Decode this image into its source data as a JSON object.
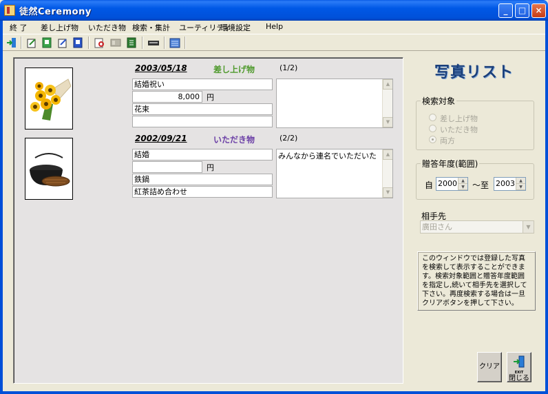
{
  "window": {
    "title": "徒然Ceremony",
    "min": "_",
    "max": "□",
    "close": "×"
  },
  "menu": [
    "終 了",
    "差し上げ物",
    "いただき物",
    "検索・集計",
    "ユーティリティ",
    "環境設定",
    "Help"
  ],
  "results": [
    {
      "date": "2003/05/18",
      "category": "差し上げ物",
      "counter": "(1/2)",
      "purpose": "結婚祝い",
      "amount": "8,000",
      "unit": "円",
      "item": "花束",
      "extra": "",
      "memo": "",
      "photo": "sunflower-bouquet"
    },
    {
      "date": "2002/09/21",
      "category": "いただき物",
      "counter": "(2/2)",
      "purpose": "結婚",
      "amount": "",
      "unit": "円",
      "item": "鉄鍋",
      "extra": "紅茶詰め合わせ",
      "memo": "みんなから連名でいただいた",
      "photo": "iron-pot"
    }
  ],
  "panel": {
    "heading": "写真リスト",
    "search_target": {
      "label": "検索対象",
      "options": [
        "差し上げ物",
        "いただき物",
        "両方"
      ],
      "selected": "両方"
    },
    "year_range": {
      "label": "贈答年度(範囲)",
      "from_label": "自",
      "from": "2000",
      "to_label": "〜至",
      "to": "2003"
    },
    "partner": {
      "label": "相手先",
      "value": "廣田さん"
    },
    "help_text": "このウィンドウでは登録した写真を検索して表示することができます。検索対象範囲と贈答年度範囲を指定し,続いて相手先を選択して下さい。再度検索する場合は一旦クリアボタンを押して下さい。",
    "clear_label": "クリア",
    "exit_small": "EXIT",
    "close_label": "閉じる"
  },
  "colors": {
    "give": "#4f9a2d",
    "receive": "#6b3fa6",
    "heading": "#1b3f7a"
  }
}
